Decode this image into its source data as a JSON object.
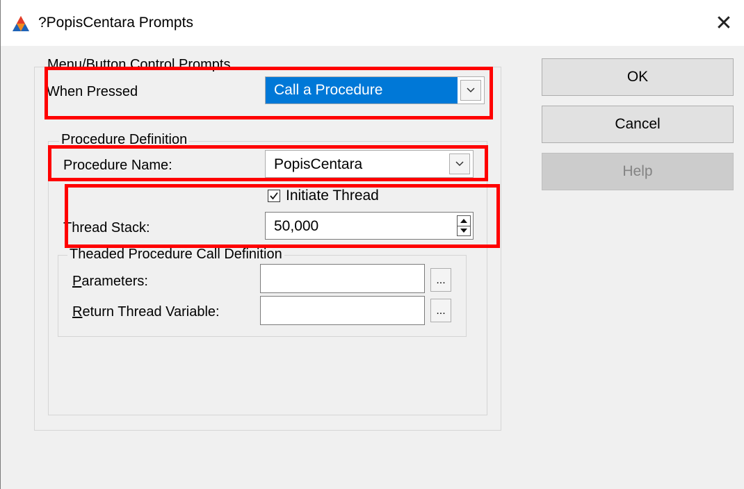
{
  "window": {
    "title": "?PopisCentara Prompts",
    "close_glyph": "✕",
    "icon": "app-triangle-icon"
  },
  "menu_group": {
    "legend": "Menu/Button Control Prompts",
    "when_pressed_label": "When Pressed",
    "when_pressed_value": "Call a Procedure"
  },
  "procedure_group": {
    "legend": "Procedure Definition",
    "procedure_name_label": "Procedure Name:",
    "procedure_name_value": "PopisCentara",
    "initiate_thread_label": "Initiate Thread",
    "initiate_thread_checked": true,
    "thread_stack_label": "Thread Stack:",
    "thread_stack_value": "50,000"
  },
  "threaded_group": {
    "legend": "Theaded Procedure Call Definition",
    "parameters_mnemonic": "P",
    "parameters_rest": "arameters:",
    "parameters_value": "",
    "return_mnemonic": "R",
    "return_rest": "eturn Thread Variable:",
    "return_value": "",
    "browse_label": "..."
  },
  "buttons": {
    "ok": "OK",
    "cancel": "Cancel",
    "help": "Help"
  },
  "colors": {
    "selection": "#0078d7",
    "highlight": "#ff0000",
    "dialog_bg": "#f0f0f0"
  }
}
